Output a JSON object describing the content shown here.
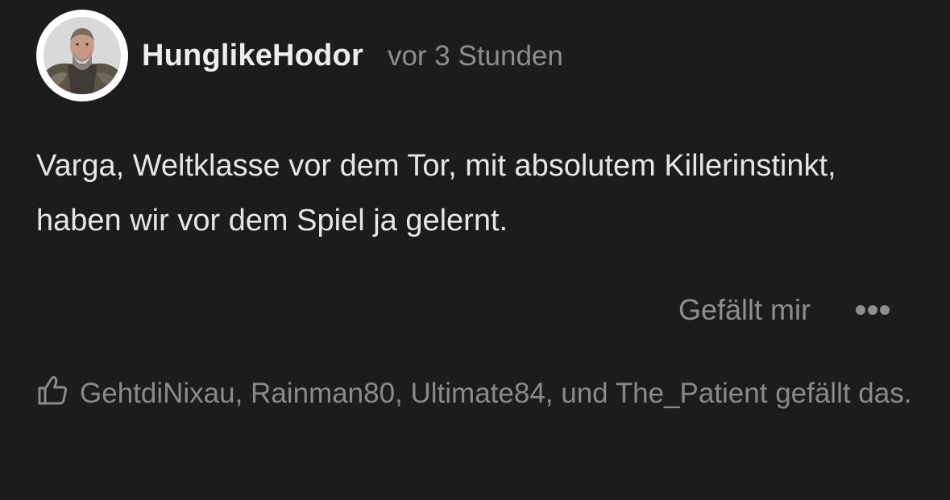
{
  "post": {
    "username": "HunglikeHodor",
    "timestamp": "vor 3 Stunden",
    "avatar_icon": "avatar-photo",
    "text": "Varga, Weltklasse vor dem Tor, mit absolutem Killerinstinkt, haben wir vor dem Spiel ja gelernt."
  },
  "actions": {
    "like_label": "Gefällt mir",
    "more_icon": "more-dots-icon"
  },
  "likes": {
    "icon": "thumbs-up-icon",
    "summary": "GehtdiNixau, Rainman80, Ultimate84, und The_Patient gefällt das."
  },
  "colors": {
    "background": "#1c1c1c",
    "username": "#ededed",
    "muted": "#8d8d8d",
    "body_text": "#e6e6e6"
  }
}
